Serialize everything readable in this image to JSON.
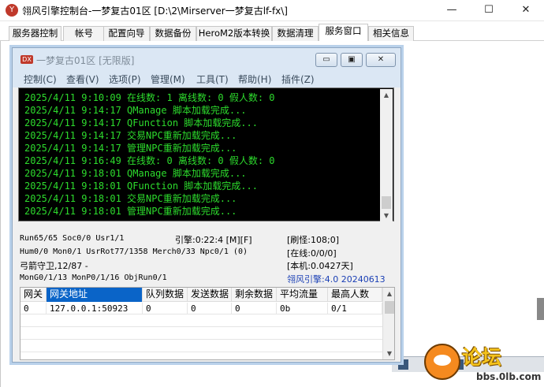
{
  "outer_window": {
    "title": "翎风引擎控制台-一梦复古01区 [D:\\2\\Mirserver一梦复古lf-fx\\]",
    "min_glyph": "—",
    "max_glyph": "☐",
    "close_glyph": "✕"
  },
  "outer_tabs": [
    {
      "label": "服务器控制"
    },
    {
      "label": "帐号"
    },
    {
      "label": "配置向导"
    },
    {
      "label": "数据备份"
    },
    {
      "label": "HeroM2版本转换"
    },
    {
      "label": "数据清理"
    },
    {
      "label": "服务窗口"
    },
    {
      "label": "相关信息"
    }
  ],
  "inner_window": {
    "icon_text": "DX",
    "title": "一梦复古01区 [无限版]",
    "min_glyph": "▭",
    "max_glyph": "▣",
    "close_glyph": "✕"
  },
  "inner_menu": [
    {
      "label": "控制(C)"
    },
    {
      "label": "查看(V)"
    },
    {
      "label": "选项(P)"
    },
    {
      "label": "管理(M)"
    },
    {
      "label": "工具(T)"
    },
    {
      "label": "帮助(H)"
    },
    {
      "label": "插件(Z)"
    }
  ],
  "console": {
    "lines": [
      "2025/4/11 9:10:09 在线数: 1 离线数: 0 假人数: 0",
      "2025/4/11 9:14:17 QManage 脚本加载完成...",
      "2025/4/11 9:14:17 QFunction 脚本加载完成...",
      "2025/4/11 9:14:17 交易NPC重新加载完成...",
      "2025/4/11 9:14:17 管理NPC重新加载完成...",
      "2025/4/11 9:16:49 在线数: 0 离线数: 0 假人数: 0",
      "2025/4/11 9:18:01 QManage 脚本加载完成...",
      "2025/4/11 9:18:01 QFunction 脚本加载完成...",
      "2025/4/11 9:18:01 交易NPC重新加载完成...",
      "2025/4/11 9:18:01 管理NPC重新加载完成..."
    ]
  },
  "status": {
    "run": "Run65/65 Soc0/0 Usr1/1",
    "engine": "引擎:0:22:4 [M][F]",
    "refresh": "[刷怪:108;0]",
    "hum": "Hum0/0 Mon0/1 UsrRot77/1358 Merch0/33 Npc0/1 (0)",
    "online": "[在线:0/0/0]",
    "archer": "弓箭守卫,12/87 -",
    "local": "[本机:0.0427天]",
    "mong": "MonG0/1/13 MonP0/1/16 ObjRun0/1",
    "version": "翎风引擎:4.0 20240613"
  },
  "gateway_table": {
    "headers": [
      "网关",
      "网关地址",
      "队列数据",
      "发送数据",
      "剩余数据",
      "平均流量",
      "最高人数"
    ],
    "rows": [
      [
        "0",
        "127.0.0.1:50923",
        "0",
        "0",
        "0",
        "0b",
        "0/1"
      ]
    ]
  },
  "watermark": {
    "text": "论坛",
    "url": "bbs.0lb.com"
  },
  "colors": {
    "console_text": "#2ddc2d",
    "selected_header": "#0a64c8",
    "status_blue": "#1a3fb5"
  }
}
